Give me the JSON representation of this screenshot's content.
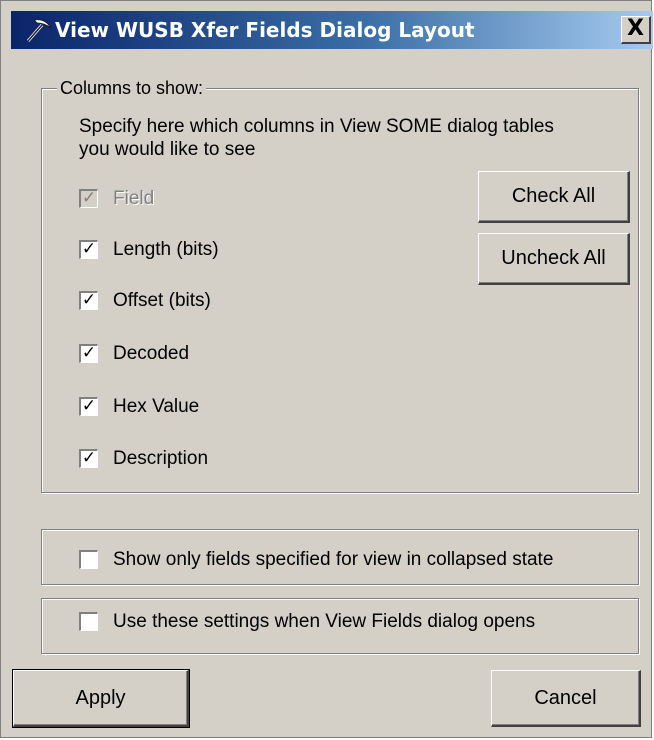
{
  "window": {
    "title": "View WUSB Xfer Fields Dialog Layout",
    "close_glyph": "X"
  },
  "columns_group": {
    "legend": "Columns to show:",
    "description": "Specify here which columns in View SOME dialog tables you would like to see",
    "check_all_label": "Check All",
    "uncheck_all_label": "Uncheck All",
    "items": [
      {
        "label": "Field",
        "checked": true,
        "disabled": true
      },
      {
        "label": "Length (bits)",
        "checked": true,
        "disabled": false
      },
      {
        "label": "Offset (bits)",
        "checked": true,
        "disabled": false
      },
      {
        "label": "Decoded",
        "checked": true,
        "disabled": false
      },
      {
        "label": "Hex Value",
        "checked": true,
        "disabled": false
      },
      {
        "label": "Description",
        "checked": true,
        "disabled": false
      }
    ]
  },
  "options": {
    "collapsed_label": "Show only fields specified for view in collapsed state",
    "collapsed_checked": false,
    "settings_label": "Use these settings when View Fields dialog opens",
    "settings_checked": false
  },
  "footer": {
    "apply_label": "Apply",
    "cancel_label": "Cancel"
  },
  "icons": {
    "title": "pickaxe-icon",
    "check": "checkmark-icon"
  },
  "colors": {
    "dialog_bg": "#d4d0c8",
    "titlebar_start": "#0a246a",
    "titlebar_end": "#a6caf0"
  }
}
